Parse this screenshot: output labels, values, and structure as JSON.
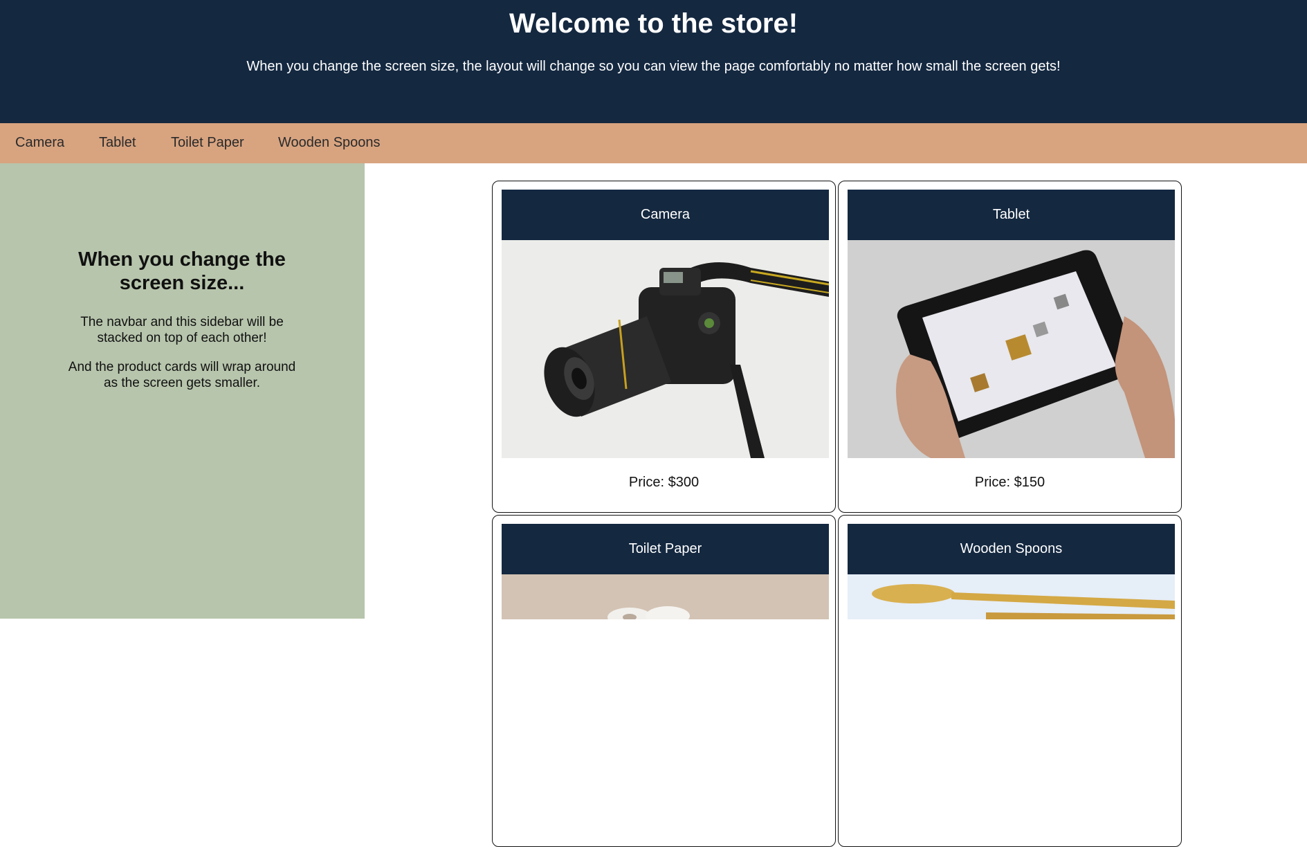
{
  "header": {
    "title": "Welcome to the store!",
    "subtitle": "When you change the screen size, the layout will change so you can view the page comfortably no matter how small the screen gets!"
  },
  "navbar": {
    "items": [
      {
        "label": "Camera"
      },
      {
        "label": "Tablet"
      },
      {
        "label": "Toilet Paper"
      },
      {
        "label": "Wooden Spoons"
      }
    ]
  },
  "sidebar": {
    "heading": "When you change the screen size...",
    "paragraph1": "The navbar and this sidebar will be stacked on top of each other!",
    "paragraph2": "And the product cards will wrap around as the screen gets smaller."
  },
  "products": [
    {
      "name": "Camera",
      "price": "Price: $300",
      "image": "camera-photo"
    },
    {
      "name": "Tablet",
      "price": "Price: $150",
      "image": "tablet-photo"
    },
    {
      "name": "Toilet Paper",
      "image": "toilet-paper-photo"
    },
    {
      "name": "Wooden Spoons",
      "image": "wooden-spoons-photo"
    }
  ],
  "colors": {
    "header_bg": "#142840",
    "navbar_bg": "#d8a480",
    "sidebar_bg": "#b7c5ac",
    "card_header_bg": "#142840"
  }
}
